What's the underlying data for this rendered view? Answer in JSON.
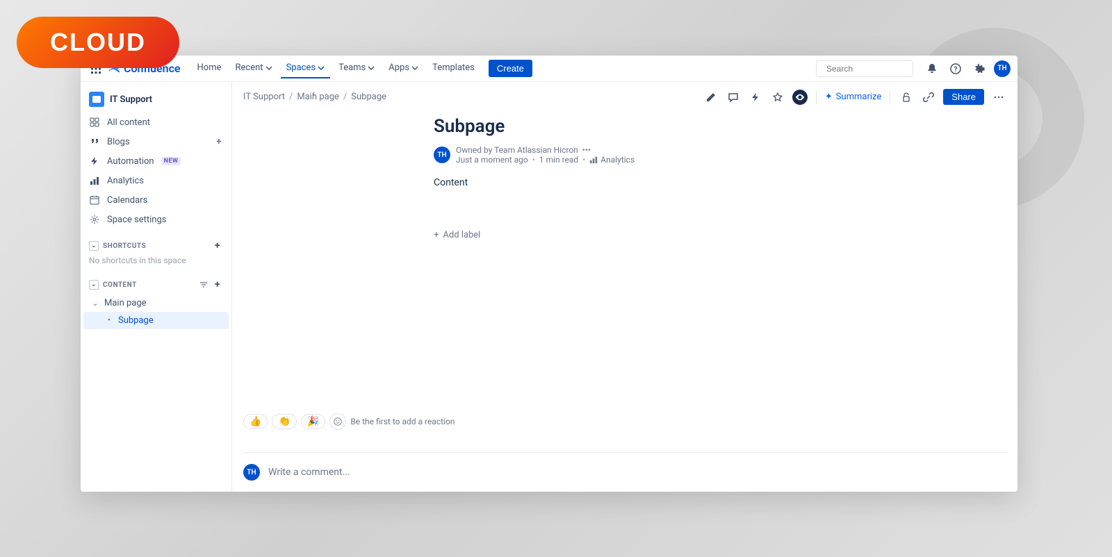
{
  "badge": {
    "label": "CLOUD"
  },
  "topnav": {
    "product": "Confluence",
    "items": {
      "home": "Home",
      "recent": "Recent",
      "spaces": "Spaces",
      "teams": "Teams",
      "apps": "Apps",
      "templates": "Templates"
    },
    "create": "Create",
    "searchPlaceholder": "Search",
    "avatar": "TH"
  },
  "sidebar": {
    "spaceName": "IT Support",
    "allContent": "All content",
    "blogs": "Blogs",
    "automation": "Automation",
    "automationBadge": "NEW",
    "analytics": "Analytics",
    "calendars": "Calendars",
    "spaceSettings": "Space settings",
    "shortcutsHeader": "SHORTCUTS",
    "shortcutsEmpty": "No shortcuts in this space",
    "contentHeader": "CONTENT",
    "tree": {
      "main": "Main page",
      "sub": "Subpage"
    }
  },
  "breadcrumbs": {
    "crumb1": "IT Support",
    "crumb2": "Main page",
    "crumb3": "Subpage"
  },
  "pageBar": {
    "summarize": "Summarize",
    "share": "Share"
  },
  "page": {
    "title": "Subpage",
    "ownedBy": "Owned by Team Atlassian Hicron",
    "avatar": "TH",
    "time": "Just a moment ago",
    "readTime": "1 min read",
    "analytics": "Analytics",
    "body": "Content",
    "addLabel": "Add label"
  },
  "reactions": {
    "r1": "👍",
    "r2": "👏",
    "r3": "🎉",
    "hint": "Be the first to add a reaction"
  },
  "comment": {
    "avatar": "TH",
    "placeholder": "Write a comment..."
  }
}
